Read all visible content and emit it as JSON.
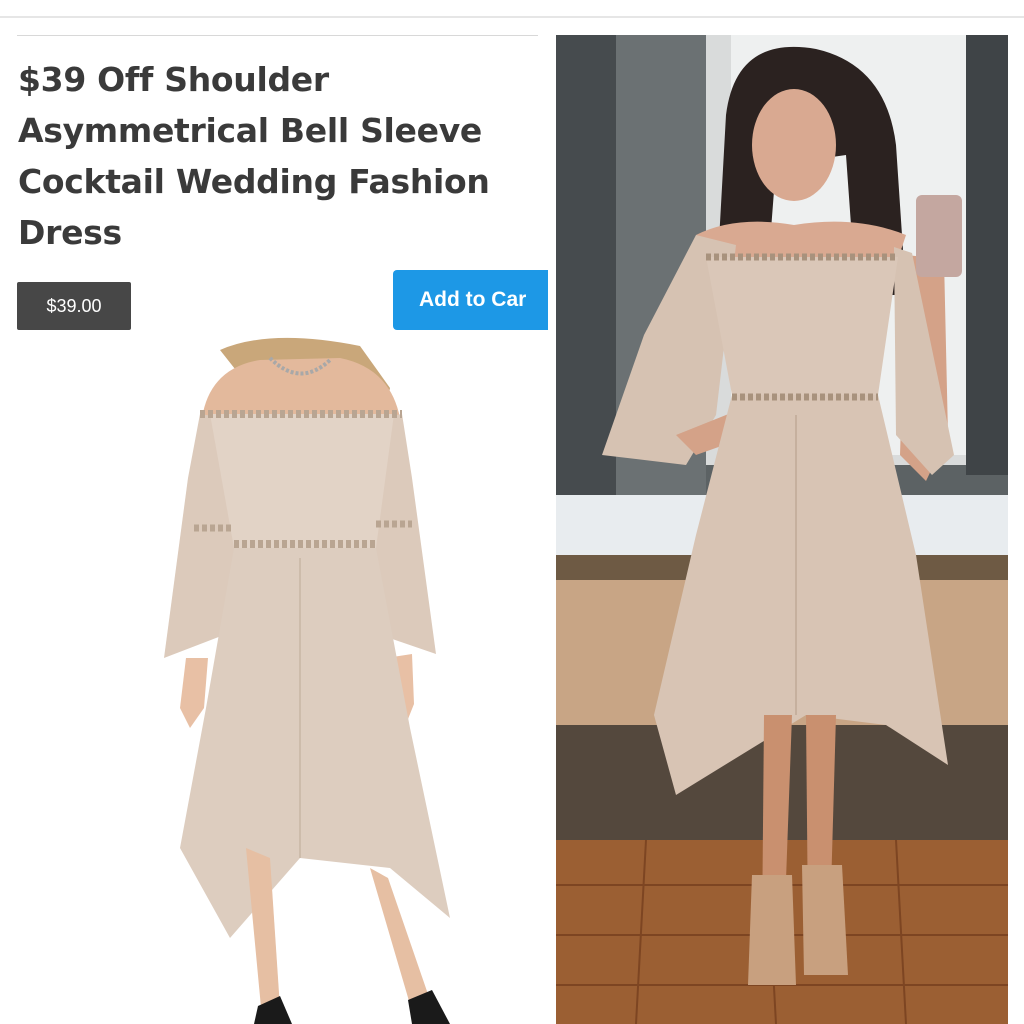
{
  "listing": {
    "title": "$39 Off Shoulder Asymmetrical Bell Sleeve Cocktail Wedding Fashion Dress",
    "price": "$39.00",
    "add_to_cart": "Add to Car"
  },
  "images": {
    "product_photo": "model-dress-photo",
    "customer_photo": "customer-mirror-selfie"
  },
  "colors": {
    "button_blue": "#1d98e6",
    "price_bg": "#474747",
    "dress": "#dccabb"
  }
}
